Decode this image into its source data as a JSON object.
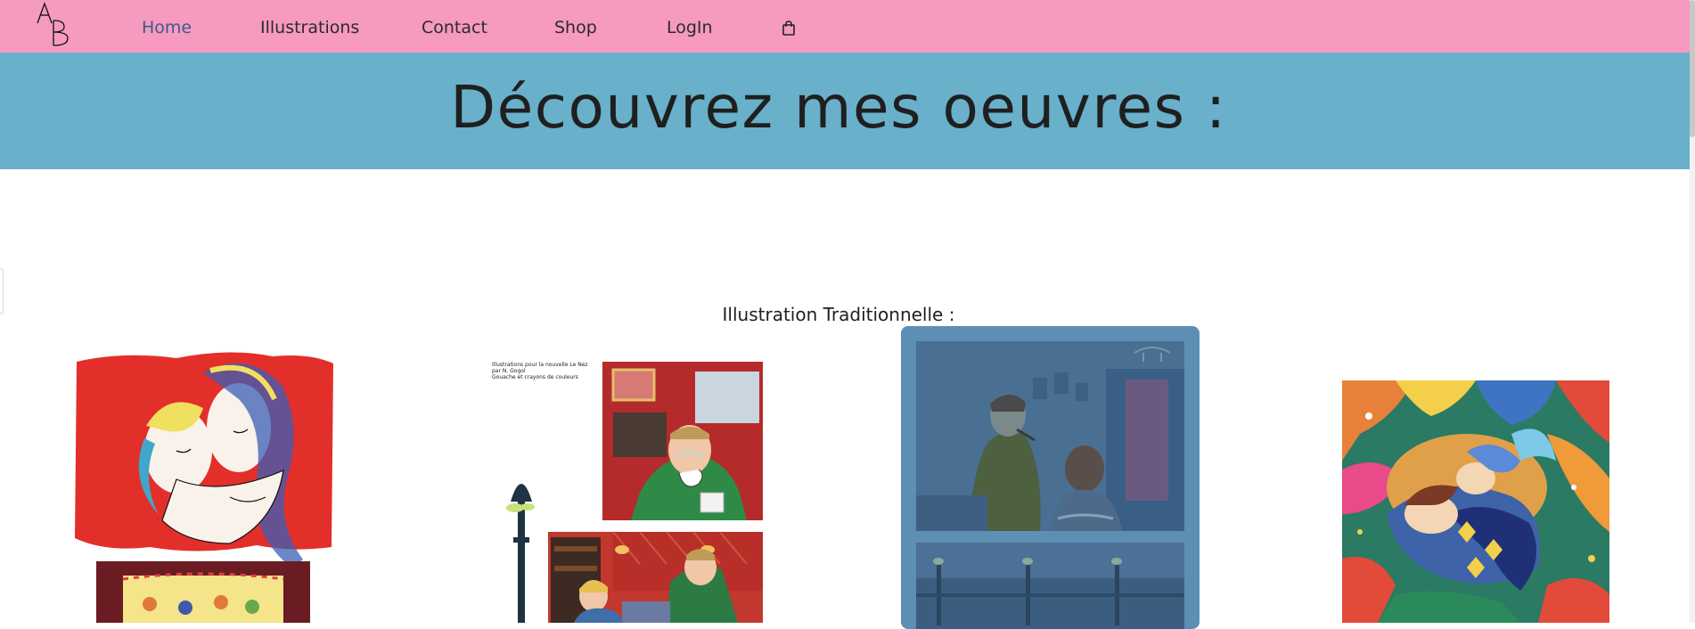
{
  "nav": {
    "logo_text": "AB",
    "items": [
      {
        "label": "Home",
        "active": true
      },
      {
        "label": "Illustrations",
        "active": false
      },
      {
        "label": "Contact",
        "active": false
      },
      {
        "label": "Shop",
        "active": false
      },
      {
        "label": "LogIn",
        "active": false
      }
    ],
    "cart_icon": "shopping-bag-icon"
  },
  "hero": {
    "title": "Découvrez mes oeuvres :"
  },
  "section": {
    "title": "Illustration Traditionnelle :"
  },
  "gallery": {
    "artwork2_caption_line1": "Illustrations pour la nouvelle Le Nez",
    "artwork2_caption_line2": "par N. Gogol",
    "artwork2_caption_line3": "Gouache et crayons de couleurs"
  },
  "colors": {
    "nav_bg": "#f69ac0",
    "hero_bg": "#69b0ca",
    "active_link": "#3f5a86",
    "hover_overlay": "#5d8fb5"
  }
}
